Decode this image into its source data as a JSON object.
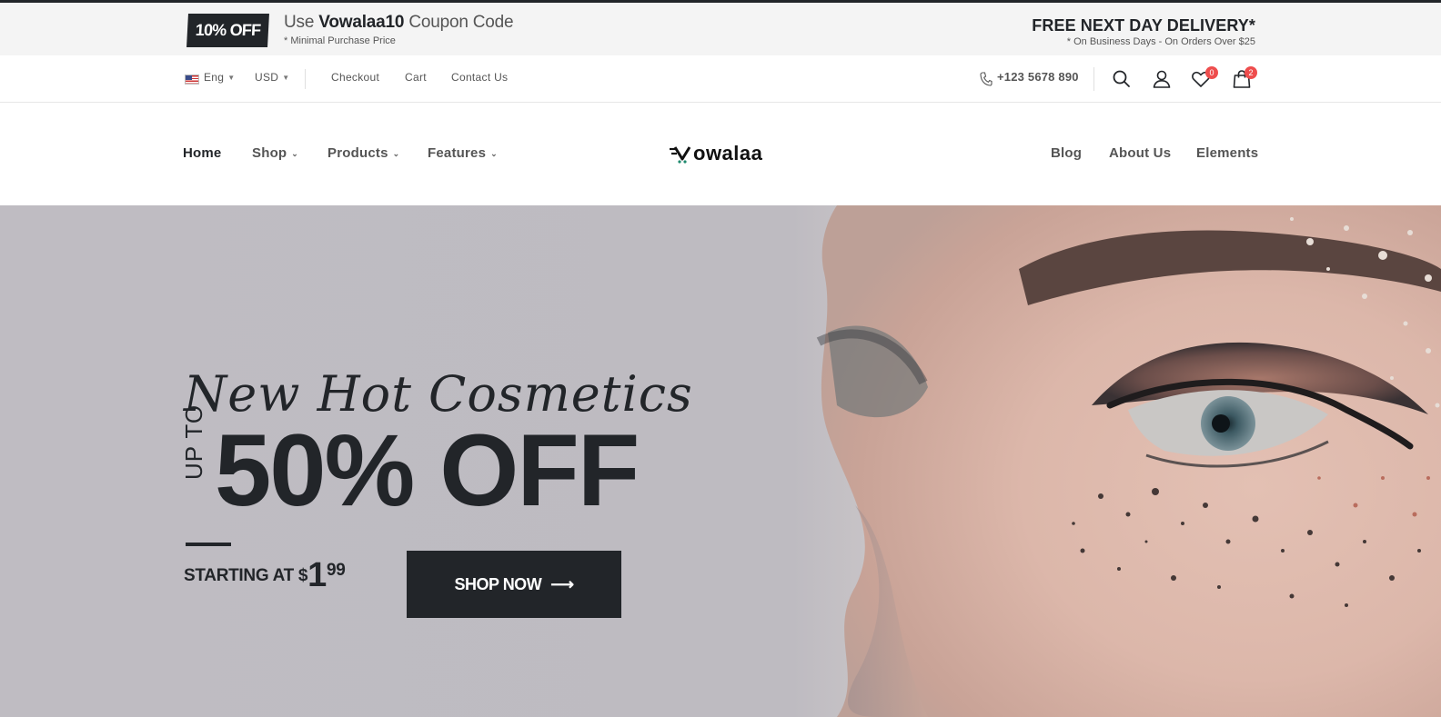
{
  "promo": {
    "badge": "10% OFF",
    "use": "Use ",
    "code": "Vowalaa10",
    "suffix": " Coupon Code",
    "note": "* Minimal Purchase Price",
    "delivery_title": "FREE NEXT DAY DELIVERY*",
    "delivery_note": "* On Business Days - On Orders Over $25"
  },
  "topbar": {
    "language": "Eng",
    "currency": "USD",
    "links": [
      "Checkout",
      "Cart",
      "Contact Us"
    ],
    "phone": "+123 5678 890",
    "wishlist_count": "0",
    "cart_count": "2"
  },
  "nav": {
    "left": [
      "Home",
      "Shop",
      "Products",
      "Features"
    ],
    "right": [
      "Blog",
      "About Us",
      "Elements"
    ],
    "logo": "owalaa"
  },
  "hero": {
    "title": "New Hot Cosmetics",
    "up_to": "UP TO",
    "discount": "50% OFF",
    "starting_prefix": "STARTING AT $",
    "price_int": "1",
    "price_cents": "99",
    "button": "SHOP NOW"
  },
  "colors": {
    "dark": "#222529",
    "accent_badge": "#ee4d4d",
    "hero_bg": "#bfbcc2"
  }
}
